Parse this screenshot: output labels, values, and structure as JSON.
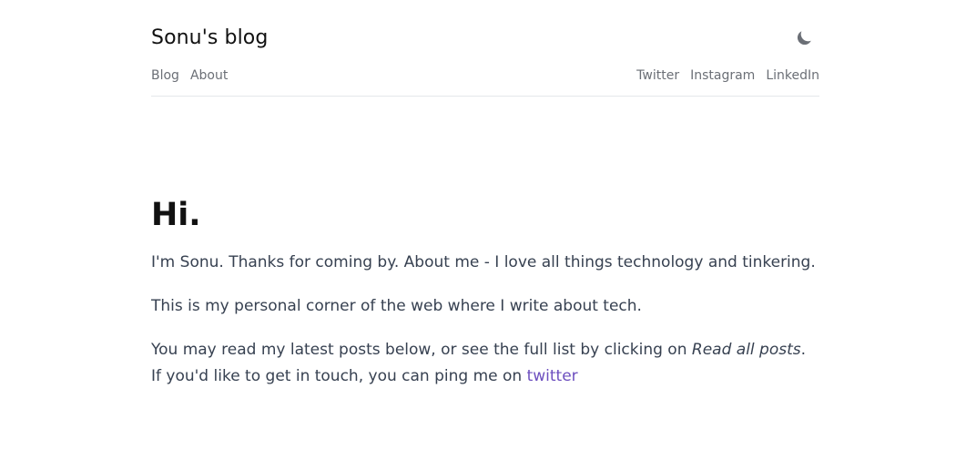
{
  "site": {
    "title": "Sonu's blog",
    "theme_toggle_icon": "moon-icon"
  },
  "nav": {
    "left": [
      "Blog",
      "About"
    ],
    "right": [
      "Twitter",
      "Instagram",
      "LinkedIn"
    ]
  },
  "intro": {
    "heading": "Hi.",
    "paragraph1": "I'm Sonu. Thanks for coming by. About me - I love all things technology and tinkering.",
    "paragraph2": "This is my personal corner of the web where I write about tech.",
    "paragraph3_prefix": "You may read my latest posts below, or see the full list by clicking on ",
    "paragraph3_emphasis": "Read all posts",
    "paragraph3_middle": ". If you'd like to get in touch, you can ping me on ",
    "paragraph3_link": "twitter"
  },
  "colors": {
    "link_accent": "#6d4fbf",
    "body_text": "#374151",
    "nav_text": "#6b6f76",
    "heading_text": "#111111",
    "divider": "#e5e7eb"
  }
}
